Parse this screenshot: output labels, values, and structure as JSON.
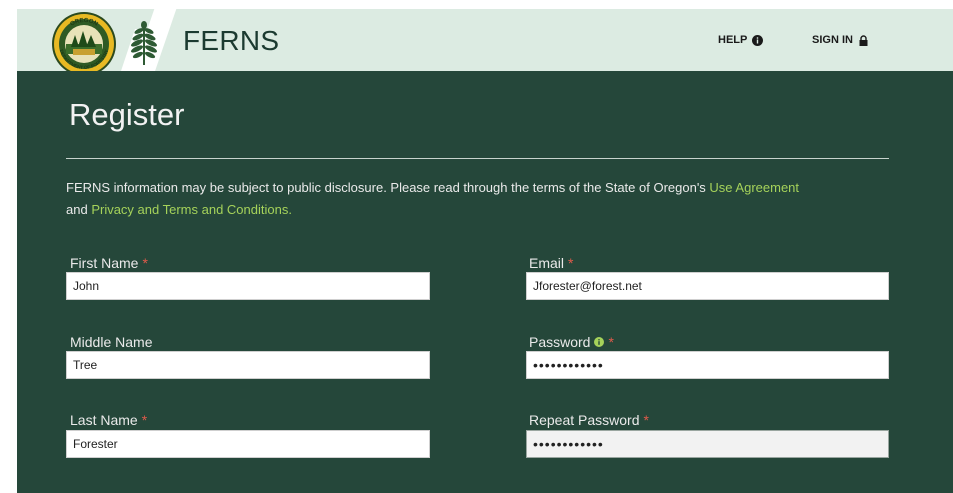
{
  "header": {
    "logo_text_top": "OREGON",
    "logo_text_bottom": "DEPARTMENT OF FORESTRY",
    "brand": "FERNS",
    "help_label": "HELP",
    "signin_label": "SIGN IN"
  },
  "page": {
    "title": "Register",
    "notice_text_1": "FERNS information may be subject to public disclosure. Please read through the terms of the State of Oregon's ",
    "use_agreement_link": "Use Agreement",
    "notice_text_2": "and ",
    "privacy_link": "Privacy and Terms and Conditions."
  },
  "form": {
    "first_name": {
      "label": "First Name",
      "required_mark": "*",
      "value": "John"
    },
    "middle_name": {
      "label": "Middle Name",
      "value": "Tree"
    },
    "last_name": {
      "label": "Last Name",
      "required_mark": "*",
      "value": "Forester"
    },
    "email": {
      "label": "Email",
      "required_mark": "*",
      "value": "Jforester@forest.net"
    },
    "password": {
      "label": "Password",
      "required_mark": "*",
      "value": "••••••••••••",
      "info_icon": "info-circle-icon"
    },
    "repeat_password": {
      "label": "Repeat Password",
      "required_mark": "*",
      "value": "••••••••••••"
    }
  },
  "colors": {
    "header_bg": "#dcebe2",
    "main_bg": "#25473a",
    "link": "#a5d25a",
    "required": "#e05a4a"
  }
}
